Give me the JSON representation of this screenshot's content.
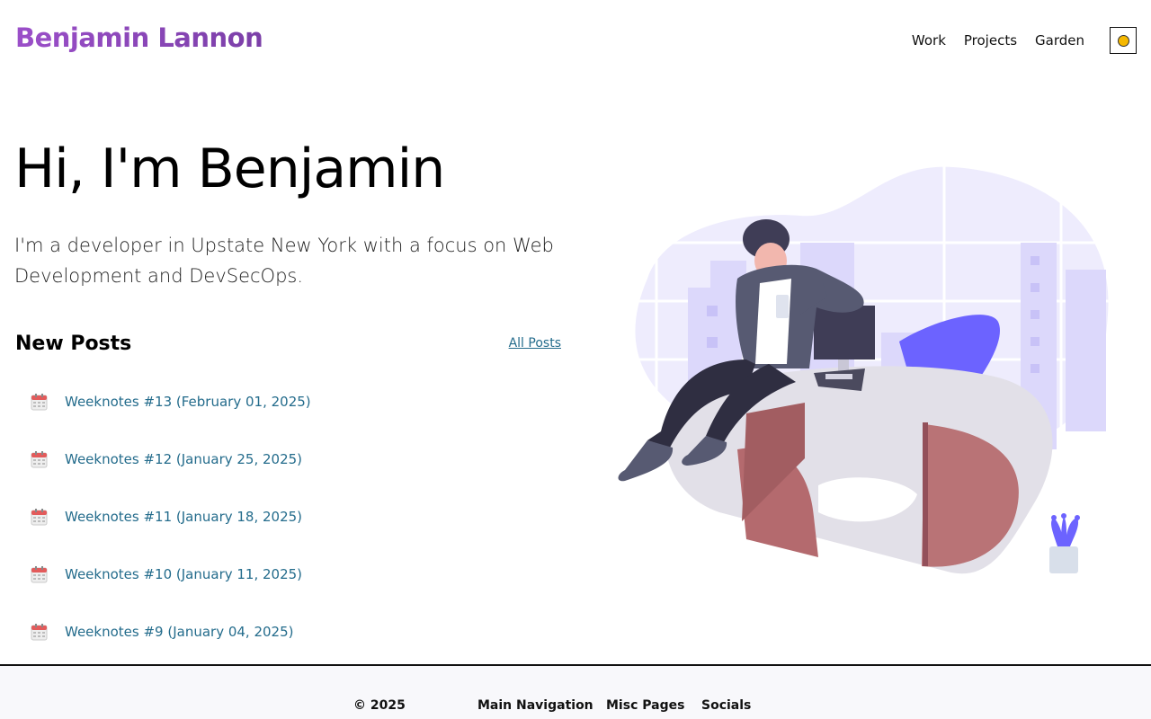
{
  "header": {
    "logo": "Benjamin Lannon",
    "nav": [
      "Work",
      "Projects",
      "Garden"
    ],
    "theme_toggle_icon": "sun-icon"
  },
  "hero": {
    "title": "Hi, I'm Benjamin",
    "subtitle": "I'm a developer in Upstate New York with a focus on Web Development and DevSecOps."
  },
  "posts": {
    "title": "New Posts",
    "all_posts_label": "All Posts",
    "items": [
      "Weeknotes #13 (February 01, 2025)",
      "Weeknotes #12 (January 25, 2025)",
      "Weeknotes #11 (January 18, 2025)",
      "Weeknotes #10 (January 11, 2025)",
      "Weeknotes #9 (January 04, 2025)"
    ]
  },
  "footer": {
    "copyright": "© 2025",
    "main_nav_heading": "Main Navigation",
    "misc_heading": "Misc Pages",
    "socials_heading": "Socials"
  },
  "colors": {
    "logo": "#8e44ad",
    "link": "#246c8c",
    "accent_purple": "#6c63ff"
  }
}
